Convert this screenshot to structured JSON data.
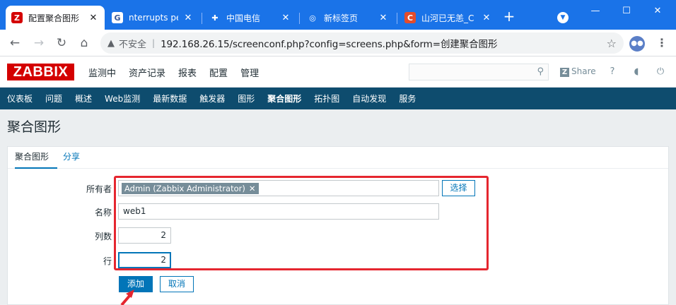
{
  "browser": {
    "tabs": [
      {
        "label": "配置聚合图形",
        "favicon": "Z",
        "favicon_color": "#d40000",
        "active": true
      },
      {
        "label": "nterrupts per",
        "favicon": "G",
        "favicon_color": "#3b5998",
        "active": false
      },
      {
        "label": "中国电信",
        "favicon": "✚",
        "favicon_color": "#1a73e8",
        "active": false
      },
      {
        "label": "新标签页",
        "favicon": "◎",
        "favicon_color": "#5f6368",
        "active": false
      },
      {
        "label": "山河已无恙_C",
        "favicon": "C",
        "favicon_color": "#e34c2c",
        "active": false
      }
    ],
    "security_label": "不安全",
    "url": "192.168.26.15/screenconf.php?config=screens.php&form=创建聚合图形"
  },
  "zabbix": {
    "logo": "ZABBIX",
    "top_menu": [
      "监测中",
      "资产记录",
      "报表",
      "配置",
      "管理"
    ],
    "share_label": "Share",
    "sub_menu": [
      "仪表板",
      "问题",
      "概述",
      "Web监测",
      "最新数据",
      "触发器",
      "图形",
      "聚合图形",
      "拓扑图",
      "自动发现",
      "服务"
    ],
    "sub_menu_selected": "聚合图形"
  },
  "page": {
    "title": "聚合图形",
    "tabs": [
      "聚合图形",
      "分享"
    ],
    "form": {
      "owner_label": "所有者",
      "owner_value": "Admin (Zabbix Administrator)",
      "select_button": "选择",
      "name_label": "名称",
      "name_value": "web1",
      "columns_label": "列数",
      "columns_value": "2",
      "rows_label": "行",
      "rows_value": "2",
      "add_button": "添加",
      "cancel_button": "取消"
    }
  },
  "colors": {
    "brand_red": "#d40000",
    "nav_blue": "#0e4c6e",
    "link_blue": "#0275b8",
    "highlight_red": "#e5262f"
  }
}
